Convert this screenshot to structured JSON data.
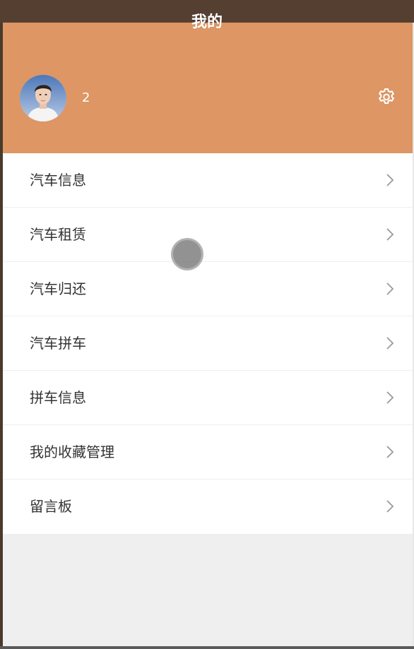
{
  "header": {
    "title": "我的",
    "username": "2",
    "settings_icon": "gear-icon",
    "background_color": "#dd9664",
    "titlebar_color": "#553f31"
  },
  "menu": {
    "items": [
      {
        "label": "汽车信息",
        "icon": "chevron-right-icon"
      },
      {
        "label": "汽车租赁",
        "icon": "chevron-right-icon"
      },
      {
        "label": "汽车归还",
        "icon": "chevron-right-icon"
      },
      {
        "label": "汽车拼车",
        "icon": "chevron-right-icon"
      },
      {
        "label": "拼车信息",
        "icon": "chevron-right-icon"
      },
      {
        "label": "我的收藏管理",
        "icon": "chevron-right-icon"
      },
      {
        "label": "留言板",
        "icon": "chevron-right-icon"
      }
    ]
  }
}
